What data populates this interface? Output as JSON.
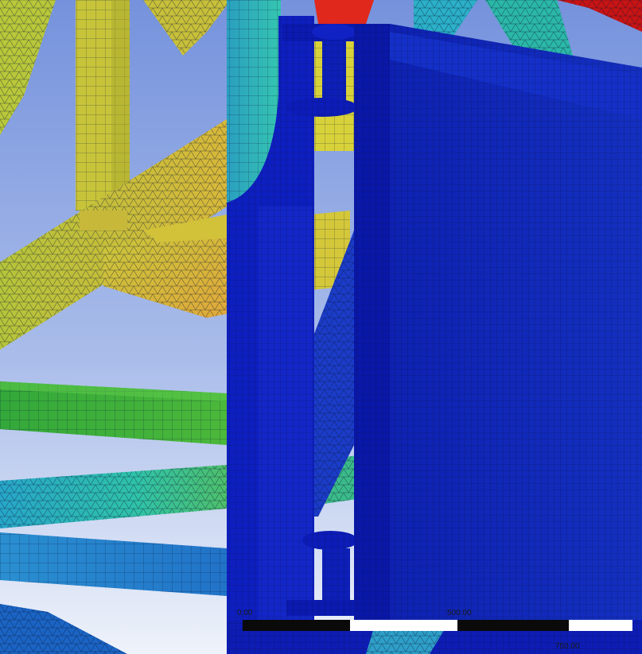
{
  "viewport": {
    "background_top": "#7d9be0",
    "background_bottom": "#e8edf8",
    "mesh_line_color": "#0b1a3a"
  },
  "contour_colors": {
    "min_blue": "#0a16c8",
    "dark_blue": "#1226b8",
    "cyan": "#2bb3c8",
    "teal": "#1f9fb0",
    "green": "#36b23a",
    "yellow_green": "#b7c83a",
    "yellow": "#d8d23a",
    "orange": "#e0a23a",
    "red": "#d41f1f"
  },
  "scale_bar": {
    "label_start": "0.00",
    "label_mid": "500.00",
    "label_end": "750.00"
  }
}
